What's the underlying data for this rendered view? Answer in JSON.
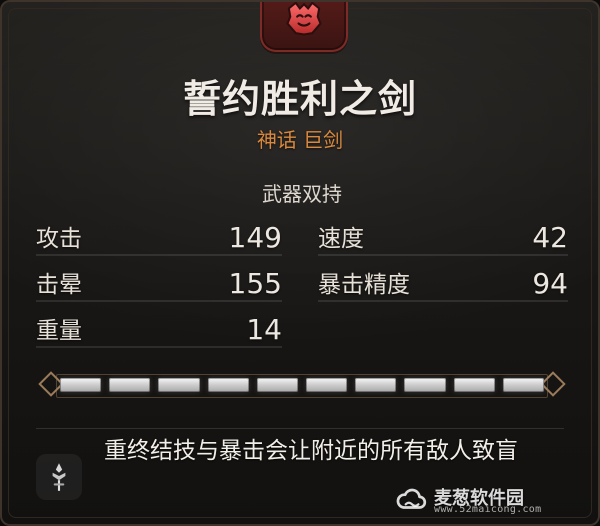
{
  "item": {
    "name": "誓约胜利之剑",
    "rarity_type": "神话 巨剑"
  },
  "section": {
    "dual_wield_label": "武器双持"
  },
  "stats": {
    "attack": {
      "label": "攻击",
      "value": "149"
    },
    "speed": {
      "label": "速度",
      "value": "42"
    },
    "stagger": {
      "label": "击晕",
      "value": "155"
    },
    "crit_precision": {
      "label": "暴击精度",
      "value": "94"
    },
    "weight": {
      "label": "重量",
      "value": "14"
    }
  },
  "slots": {
    "count": 10,
    "filled": 10
  },
  "ability": {
    "icon": "sword-emblem-icon",
    "text": "重终结技与暴击会让附近的所有敌人致盲"
  },
  "watermark": {
    "title": "麦葱软件园",
    "url": "www.52maicong.com"
  },
  "colors": {
    "panel": "#1a1816",
    "accent_orange": "#d9893d",
    "emblem_red": "#5b1d1a",
    "slot_fill": "#d0d0d0"
  }
}
